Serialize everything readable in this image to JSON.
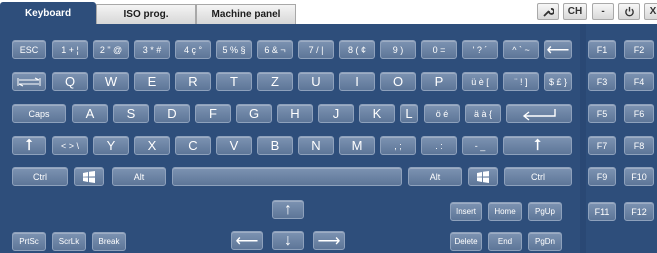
{
  "tabs": [
    {
      "label": "Keyboard",
      "active": true
    },
    {
      "label": "ISO prog.",
      "active": false
    },
    {
      "label": "Machine panel",
      "active": false
    }
  ],
  "toolbar": {
    "wrench_icon": "wrench-icon",
    "layout_label": "CH",
    "minimize_label": "-",
    "power_icon": "power-icon",
    "close_label": "X"
  },
  "keys": {
    "row1": [
      "ESC",
      "1 + ¦",
      "2 \" @",
      "3 * #",
      "4 ç °",
      "5 % §",
      "6 & ¬",
      "7 / |",
      "8 ( ¢",
      "9 )",
      "0 =",
      "' ? ´",
      "^ ` ~"
    ],
    "row2": [
      "Q",
      "W",
      "E",
      "R",
      "T",
      "Z",
      "U",
      "I",
      "O",
      "P",
      "ü è [",
      "¨ ! ]",
      "$ £ }"
    ],
    "row3_caps": "Caps",
    "row3": [
      "A",
      "S",
      "D",
      "F",
      "G",
      "H",
      "J",
      "K",
      "L",
      "ö é",
      "ä à {"
    ],
    "row4": [
      "< > \\",
      "Y",
      "X",
      "C",
      "V",
      "B",
      "N",
      "M",
      ", ;",
      ". :",
      "- _"
    ],
    "ctrl_left": "Ctrl",
    "alt_left": "Alt",
    "alt_right": "Alt",
    "ctrl_right": "Ctrl",
    "nav": {
      "insert": "Insert",
      "home": "Home",
      "pgup": "PgUp",
      "delete": "Delete",
      "end": "End",
      "pgdn": "PgDn"
    },
    "misc": {
      "prtsc": "PrtSc",
      "scrlk": "ScrLk",
      "break": "Break"
    },
    "fkeys": [
      "F1",
      "F2",
      "F3",
      "F4",
      "F5",
      "F6",
      "F7",
      "F8",
      "F9",
      "F10",
      "F11",
      "F12"
    ]
  },
  "colors": {
    "background": "#2e4e7b",
    "key": "#6d84a5",
    "key_text": "#ffffff",
    "tab_active": "#2e4e7b"
  }
}
